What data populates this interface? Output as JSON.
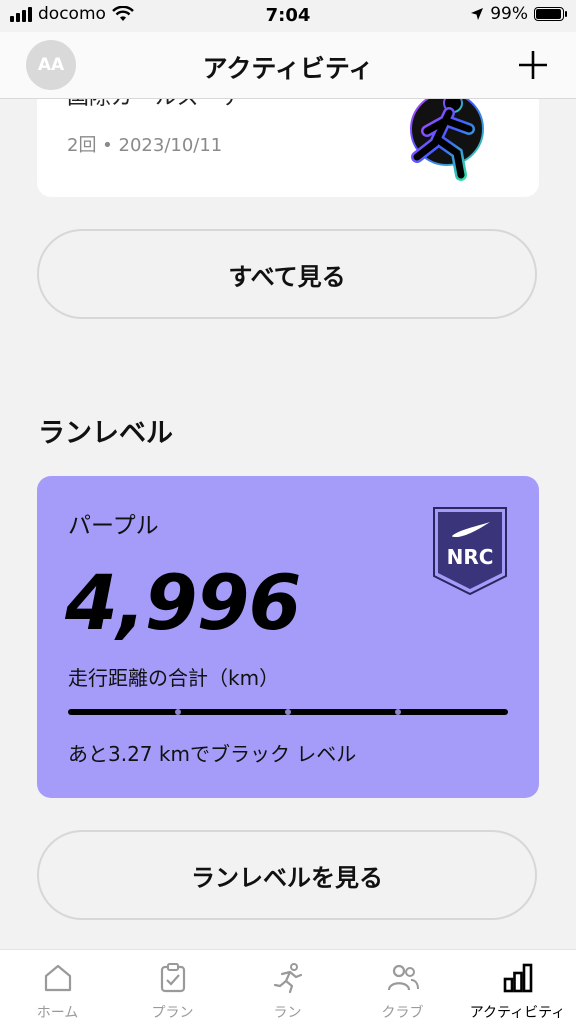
{
  "status_bar": {
    "carrier": "docomo",
    "time": "7:04",
    "battery": "99%"
  },
  "header": {
    "avatar_initials": "AA",
    "title": "アクティビティ",
    "add_icon": "plus-icon"
  },
  "badge_card": {
    "title": "国際ガールズ・デー",
    "meta": "2回 • 2023/10/11",
    "image": "running-figure-badge"
  },
  "see_all_button": {
    "label": "すべて見る"
  },
  "run_level_section": {
    "title": "ランレベル",
    "level_name": "パープル",
    "total_distance": "4,996",
    "distance_label": "走行距離の合計（km）",
    "remaining_text": "あと3.27 kmでブラック レベル",
    "progress_fraction": 0.999,
    "card_color": "#a59cf9",
    "badge_text": "NRC"
  },
  "run_level_button": {
    "label": "ランレベルを見る"
  },
  "tabbar": {
    "items": [
      {
        "label": "ホーム",
        "icon": "home-icon"
      },
      {
        "label": "プラン",
        "icon": "clipboard-check-icon"
      },
      {
        "label": "ラン",
        "icon": "runner-icon"
      },
      {
        "label": "クラブ",
        "icon": "people-icon"
      },
      {
        "label": "アクティビティ",
        "icon": "bar-chart-icon",
        "active": true
      }
    ]
  }
}
